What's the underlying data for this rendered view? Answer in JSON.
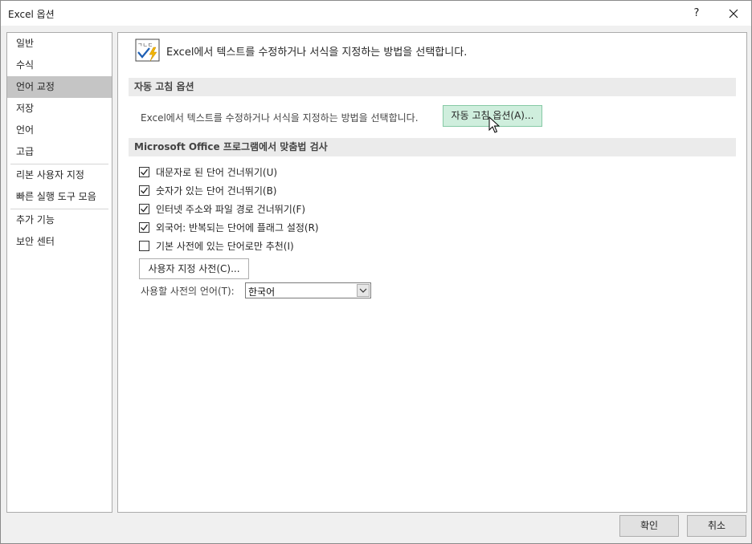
{
  "window": {
    "title": "Excel 옵션",
    "help_label": "?",
    "help_icon": "help-icon",
    "close_icon": "close-icon"
  },
  "sidebar": {
    "items": [
      {
        "label": "일반"
      },
      {
        "label": "수식"
      },
      {
        "label": "언어 교정",
        "selected": true
      },
      {
        "label": "저장"
      },
      {
        "label": "언어"
      },
      {
        "label": "고급"
      },
      {
        "label": "리본 사용자 지정"
      },
      {
        "label": "빠른 실행 도구 모음"
      },
      {
        "label": "추가 기능"
      },
      {
        "label": "보안 센터"
      }
    ]
  },
  "main": {
    "header_icon": "proofing-icon",
    "header_icon_text": "ㄱㄴㄷ",
    "header_text": "Excel에서 텍스트를 수정하거나 서식을 지정하는 방법을 선택합니다.",
    "autocorrect": {
      "section_title": "자동 고침 옵션",
      "description": "Excel에서 텍스트를 수정하거나 서식을 지정하는 방법을 선택합니다.",
      "button_label": "자동 고침 옵션(A)..."
    },
    "spelling": {
      "section_title": "Microsoft Office 프로그램에서 맞춤법 검사",
      "options": [
        {
          "label": "대문자로 된 단어 건너뛰기(U)",
          "checked": true
        },
        {
          "label": "숫자가 있는 단어 건너뛰기(B)",
          "checked": true
        },
        {
          "label": "인터넷 주소와 파일 경로 건너뛰기(F)",
          "checked": true
        },
        {
          "label": "외국어: 반복되는 단어에 플래그 설정(R)",
          "checked": true
        },
        {
          "label": "기본 사전에 있는 단어로만 추천(I)",
          "checked": false
        }
      ],
      "custom_dict_button": "사용자 지정 사전(C)...",
      "dictionary_language_label": "사용할 사전의 언어(T):",
      "dictionary_language_value": "한국어"
    }
  },
  "footer": {
    "ok_label": "확인",
    "cancel_label": "취소"
  },
  "colors": {
    "selected_nav": "#c5c5c5",
    "section_header": "#ebebeb",
    "autocorrect_button": "#cfeedd",
    "autocorrect_button_border": "#86c9a5",
    "icon_check_blue": "#1e5fb4",
    "icon_bolt_yellow": "#f2b400"
  }
}
